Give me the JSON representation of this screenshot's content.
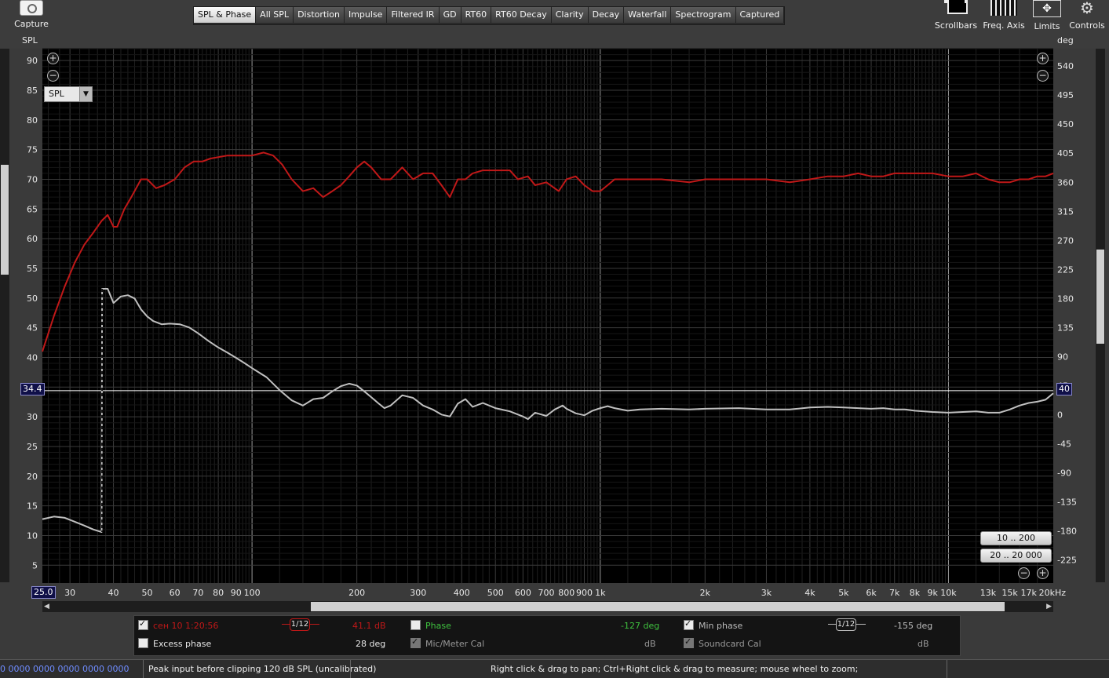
{
  "toolbar": {
    "capture": "Capture",
    "scrollbars": "Scrollbars",
    "freq_axis": "Freq. Axis",
    "limits": "Limits",
    "controls": "Controls"
  },
  "tabs": [
    "SPL & Phase",
    "All SPL",
    "Distortion",
    "Impulse",
    "Filtered IR",
    "GD",
    "RT60",
    "RT60 Decay",
    "Clarity",
    "Decay",
    "Waterfall",
    "Spectrogram",
    "Captured"
  ],
  "active_tab": 0,
  "selector": {
    "value": "SPL"
  },
  "cursor": {
    "left_value": "34.4",
    "right_value": "40",
    "x_value": "25.0"
  },
  "range_buttons": [
    "10 .. 200",
    "20 .. 20 000"
  ],
  "legend": {
    "trace1_name": "сен 10 1:20:56",
    "smoothing1": "1/12",
    "trace1_value": "41.1 dB",
    "phase_label": "Phase",
    "phase_value": "-127 deg",
    "min_phase_label": "Min phase",
    "smoothing2": "1/12",
    "min_phase_value": "-155 deg",
    "excess_phase_label": "Excess phase",
    "excess_phase_value": "28 deg",
    "mic_cal_label": "Mic/Meter Cal",
    "mic_cal_unit": "dB",
    "soundcard_cal_label": "Soundcard Cal",
    "soundcard_cal_unit": "dB",
    "color_trace": "#c01818",
    "color_phase": "#3fc23f"
  },
  "status": {
    "left_counters": "0 0000  0000 0000  0000 0000",
    "peak": "Peak input before clipping 120 dB SPL (uncalibrated)",
    "hint": "Right click & drag to pan; Ctrl+Right click & drag to measure; mouse wheel to zoom;"
  },
  "chart_data": {
    "type": "line",
    "xscale": "log",
    "xlim": [
      25,
      20000
    ],
    "ylabel": "SPL",
    "ylabel_right": "deg",
    "ylim": [
      2,
      92
    ],
    "ylim_right": [
      -261,
      567
    ],
    "yticks_left": [
      5,
      10,
      15,
      20,
      25,
      30,
      35,
      40,
      45,
      50,
      55,
      60,
      65,
      70,
      75,
      80,
      85,
      90
    ],
    "yticks_right": [
      -225,
      -180,
      -135,
      -90,
      -45,
      0,
      45,
      90,
      135,
      180,
      225,
      270,
      315,
      360,
      405,
      450,
      495,
      540
    ],
    "xticks": [
      {
        "v": 30,
        "t": "30"
      },
      {
        "v": 40,
        "t": "40"
      },
      {
        "v": 50,
        "t": "50"
      },
      {
        "v": 60,
        "t": "60"
      },
      {
        "v": 70,
        "t": "70"
      },
      {
        "v": 80,
        "t": "80"
      },
      {
        "v": 90,
        "t": "90"
      },
      {
        "v": 100,
        "t": "100"
      },
      {
        "v": 200,
        "t": "200"
      },
      {
        "v": 300,
        "t": "300"
      },
      {
        "v": 400,
        "t": "400"
      },
      {
        "v": 500,
        "t": "500"
      },
      {
        "v": 600,
        "t": "600"
      },
      {
        "v": 700,
        "t": "700"
      },
      {
        "v": 800,
        "t": "800"
      },
      {
        "v": 900,
        "t": "900"
      },
      {
        "v": 1000,
        "t": "1k"
      },
      {
        "v": 2000,
        "t": "2k"
      },
      {
        "v": 3000,
        "t": "3k"
      },
      {
        "v": 4000,
        "t": "4k"
      },
      {
        "v": 5000,
        "t": "5k"
      },
      {
        "v": 6000,
        "t": "6k"
      },
      {
        "v": 7000,
        "t": "7k"
      },
      {
        "v": 8000,
        "t": "8k"
      },
      {
        "v": 9000,
        "t": "9k"
      },
      {
        "v": 10000,
        "t": "10k"
      },
      {
        "v": 13000,
        "t": "13k"
      },
      {
        "v": 15000,
        "t": "15k"
      },
      {
        "v": 17000,
        "t": "17k"
      },
      {
        "v": 20000,
        "t": "20kHz"
      }
    ],
    "cursor_y": 34.4,
    "series": [
      {
        "color": "#c01818",
        "points": [
          [
            25,
            41
          ],
          [
            27,
            47
          ],
          [
            29,
            52
          ],
          [
            31,
            56
          ],
          [
            33,
            59
          ],
          [
            35,
            61
          ],
          [
            37,
            63
          ],
          [
            38.5,
            64
          ],
          [
            40,
            62
          ],
          [
            41,
            62
          ],
          [
            43,
            65
          ],
          [
            45,
            67
          ],
          [
            48,
            70
          ],
          [
            50,
            70
          ],
          [
            53,
            68.5
          ],
          [
            56,
            69
          ],
          [
            60,
            70
          ],
          [
            64,
            72
          ],
          [
            68,
            73
          ],
          [
            72,
            73
          ],
          [
            76,
            73.5
          ],
          [
            85,
            74
          ],
          [
            95,
            74
          ],
          [
            100,
            74
          ],
          [
            108,
            74.5
          ],
          [
            115,
            74
          ],
          [
            122,
            72.5
          ],
          [
            130,
            70
          ],
          [
            140,
            68
          ],
          [
            150,
            68.5
          ],
          [
            160,
            67
          ],
          [
            170,
            68
          ],
          [
            180,
            69
          ],
          [
            190,
            70.5
          ],
          [
            200,
            72
          ],
          [
            210,
            73
          ],
          [
            220,
            72
          ],
          [
            235,
            70
          ],
          [
            250,
            70
          ],
          [
            270,
            72
          ],
          [
            290,
            70
          ],
          [
            310,
            71
          ],
          [
            330,
            71
          ],
          [
            350,
            69
          ],
          [
            370,
            67
          ],
          [
            390,
            70
          ],
          [
            410,
            70
          ],
          [
            430,
            71
          ],
          [
            460,
            71.5
          ],
          [
            500,
            71.5
          ],
          [
            550,
            71.5
          ],
          [
            580,
            70
          ],
          [
            620,
            70.5
          ],
          [
            650,
            69
          ],
          [
            700,
            69.5
          ],
          [
            760,
            68
          ],
          [
            800,
            70
          ],
          [
            850,
            70.5
          ],
          [
            900,
            69
          ],
          [
            950,
            68
          ],
          [
            1000,
            68
          ],
          [
            1050,
            69
          ],
          [
            1100,
            70
          ],
          [
            1200,
            70
          ],
          [
            1300,
            70
          ],
          [
            1500,
            70
          ],
          [
            1800,
            69.5
          ],
          [
            2000,
            70
          ],
          [
            2500,
            70
          ],
          [
            3000,
            70
          ],
          [
            3500,
            69.5
          ],
          [
            4000,
            70
          ],
          [
            4500,
            70.5
          ],
          [
            5000,
            70.5
          ],
          [
            5500,
            71
          ],
          [
            6000,
            70.5
          ],
          [
            6500,
            70.5
          ],
          [
            7000,
            71
          ],
          [
            7500,
            71
          ],
          [
            8000,
            71
          ],
          [
            9000,
            71
          ],
          [
            10000,
            70.5
          ],
          [
            11000,
            70.5
          ],
          [
            12000,
            71
          ],
          [
            13000,
            70
          ],
          [
            14000,
            69.5
          ],
          [
            15000,
            69.5
          ],
          [
            16000,
            70
          ],
          [
            17000,
            70
          ],
          [
            18000,
            70.5
          ],
          [
            19000,
            70.5
          ],
          [
            20000,
            71
          ]
        ]
      },
      {
        "color": "#c0c0c0",
        "axis": "right",
        "points": [
          [
            25,
            -162
          ],
          [
            27,
            -158
          ],
          [
            29,
            -160
          ],
          [
            31,
            -166
          ],
          [
            33,
            -172
          ],
          [
            35,
            -178
          ],
          [
            37,
            -182
          ],
          [
            37.1,
            195
          ],
          [
            38.5,
            195
          ],
          [
            40,
            173
          ],
          [
            42,
            183
          ],
          [
            44,
            185
          ],
          [
            46,
            180
          ],
          [
            48,
            163
          ],
          [
            50,
            152
          ],
          [
            52,
            145
          ],
          [
            55,
            140
          ],
          [
            58,
            141
          ],
          [
            62,
            140
          ],
          [
            66,
            135
          ],
          [
            70,
            126
          ],
          [
            75,
            114
          ],
          [
            80,
            104
          ],
          [
            85,
            96
          ],
          [
            90,
            88
          ],
          [
            95,
            80
          ],
          [
            100,
            72
          ],
          [
            110,
            58
          ],
          [
            120,
            38
          ],
          [
            130,
            22
          ],
          [
            140,
            14
          ],
          [
            150,
            24
          ],
          [
            160,
            26
          ],
          [
            170,
            36
          ],
          [
            180,
            44
          ],
          [
            190,
            48
          ],
          [
            200,
            45
          ],
          [
            210,
            36
          ],
          [
            220,
            27
          ],
          [
            230,
            18
          ],
          [
            240,
            10
          ],
          [
            250,
            14
          ],
          [
            270,
            30
          ],
          [
            290,
            26
          ],
          [
            310,
            14
          ],
          [
            330,
            8
          ],
          [
            350,
            0
          ],
          [
            370,
            -3
          ],
          [
            390,
            17
          ],
          [
            410,
            24
          ],
          [
            430,
            12
          ],
          [
            460,
            18
          ],
          [
            500,
            10
          ],
          [
            550,
            5
          ],
          [
            600,
            -3
          ],
          [
            620,
            -7
          ],
          [
            650,
            3
          ],
          [
            700,
            -2
          ],
          [
            740,
            8
          ],
          [
            780,
            14
          ],
          [
            800,
            9
          ],
          [
            850,
            2
          ],
          [
            900,
            -1
          ],
          [
            950,
            6
          ],
          [
            1000,
            10
          ],
          [
            1050,
            13
          ],
          [
            1100,
            10
          ],
          [
            1200,
            6
          ],
          [
            1300,
            8
          ],
          [
            1500,
            9
          ],
          [
            1800,
            8
          ],
          [
            2000,
            9
          ],
          [
            2500,
            10
          ],
          [
            3000,
            8
          ],
          [
            3500,
            8
          ],
          [
            4000,
            11
          ],
          [
            4500,
            12
          ],
          [
            5000,
            11
          ],
          [
            5500,
            10
          ],
          [
            6000,
            9
          ],
          [
            6500,
            10
          ],
          [
            7000,
            8
          ],
          [
            7500,
            8
          ],
          [
            8000,
            6
          ],
          [
            9000,
            4
          ],
          [
            10000,
            3
          ],
          [
            11000,
            4
          ],
          [
            12000,
            5
          ],
          [
            13000,
            3
          ],
          [
            14000,
            3
          ],
          [
            15000,
            8
          ],
          [
            16000,
            14
          ],
          [
            17000,
            18
          ],
          [
            18000,
            20
          ],
          [
            19000,
            23
          ],
          [
            20000,
            33
          ]
        ]
      }
    ]
  }
}
